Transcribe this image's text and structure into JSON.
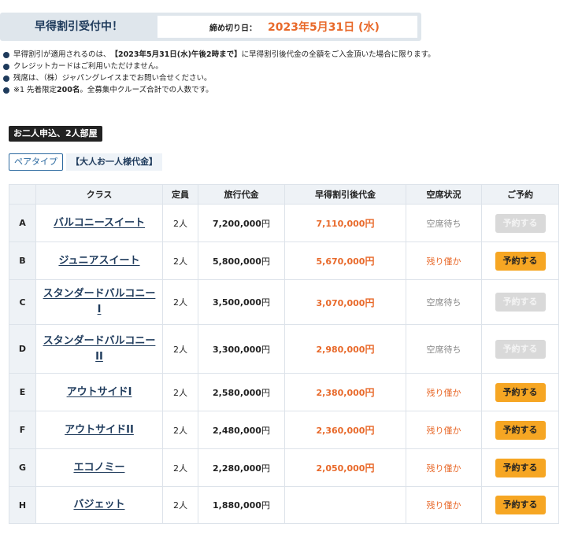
{
  "banner": {
    "title": "早得割引受付中！",
    "deadline_label": "締め切り日：",
    "deadline_date": "2023年5月31日 (水)"
  },
  "notes": [
    {
      "pre": "早得割引が適用されるのは、",
      "bold": "【2023年5月31日(水)午後2時まで】",
      "post": "に早得割引後代金の全額をご入金頂いた場合に限ります。"
    },
    {
      "pre": "クレジットカードはご利用いただけません。",
      "bold": "",
      "post": ""
    },
    {
      "pre": "残席は、（株）ジャパングレイスまでお問い合せください。",
      "bold": "",
      "post": ""
    },
    {
      "pre": "※1 先着限定",
      "bold": "200名",
      "post": "。全募集中クルーズ合計での人数です。"
    }
  ],
  "room_badge": "お二人申込、2人部屋",
  "pair_tab": "ペアタイプ",
  "price_note": "【大人お一人様代金】",
  "table": {
    "headers": [
      "",
      "クラス",
      "定員",
      "旅行代金",
      "早得割引後代金",
      "空席状況",
      "ご予約"
    ],
    "rows": [
      {
        "code": "A",
        "line1": "バルコニースイート",
        "line2": "",
        "capacity": "2人",
        "tour_num": "7,200,000",
        "tour_unit": "円",
        "early_num": "7,110,000",
        "early_unit": "円",
        "status": "空席待ち",
        "status_type": "wait",
        "button": "予約する",
        "button_enabled": false
      },
      {
        "code": "B",
        "line1": "ジュニアスイート",
        "line2": "",
        "capacity": "2人",
        "tour_num": "5,800,000",
        "tour_unit": "円",
        "early_num": "5,670,000",
        "early_unit": "円",
        "status": "残り僅か",
        "status_type": "few",
        "button": "予約する",
        "button_enabled": true
      },
      {
        "code": "C",
        "line1": "スタンダードバルコニー",
        "line2": "I",
        "capacity": "2人",
        "tour_num": "3,500,000",
        "tour_unit": "円",
        "early_num": "3,070,000",
        "early_unit": "円",
        "status": "空席待ち",
        "status_type": "wait",
        "button": "予約する",
        "button_enabled": false
      },
      {
        "code": "D",
        "line1": "スタンダードバルコニー",
        "line2": "II",
        "capacity": "2人",
        "tour_num": "3,300,000",
        "tour_unit": "円",
        "early_num": "2,980,000",
        "early_unit": "円",
        "status": "空席待ち",
        "status_type": "wait",
        "button": "予約する",
        "button_enabled": false
      },
      {
        "code": "E",
        "line1": "アウトサイドI",
        "line2": "",
        "capacity": "2人",
        "tour_num": "2,580,000",
        "tour_unit": "円",
        "early_num": "2,380,000",
        "early_unit": "円",
        "status": "残り僅か",
        "status_type": "few",
        "button": "予約する",
        "button_enabled": true
      },
      {
        "code": "F",
        "line1": "アウトサイドII",
        "line2": "",
        "capacity": "2人",
        "tour_num": "2,480,000",
        "tour_unit": "円",
        "early_num": "2,360,000",
        "early_unit": "円",
        "status": "残り僅か",
        "status_type": "few",
        "button": "予約する",
        "button_enabled": true
      },
      {
        "code": "G",
        "line1": "エコノミー",
        "line2": "",
        "capacity": "2人",
        "tour_num": "2,280,000",
        "tour_unit": "円",
        "early_num": "2,050,000",
        "early_unit": "円",
        "status": "残り僅か",
        "status_type": "few",
        "button": "予約する",
        "button_enabled": true
      },
      {
        "code": "H",
        "line1": "バジェット",
        "line2": "",
        "capacity": "2人",
        "tour_num": "1,880,000",
        "tour_unit": "円",
        "early_num": "",
        "early_unit": "",
        "status": "残り僅か",
        "status_type": "few",
        "button": "予約する",
        "button_enabled": true
      }
    ]
  },
  "colors": {
    "accent_orange": "#e8692a",
    "navy": "#1f3b5c",
    "button_yellow": "#f6a623",
    "button_disabled": "#d9d9d9"
  }
}
